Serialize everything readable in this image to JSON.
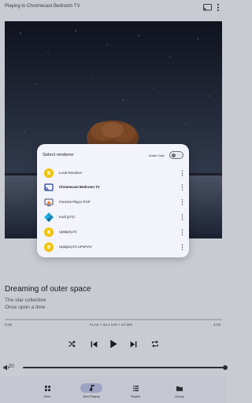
{
  "topbar": {
    "title": "Playing to Chromecast Bedroom TV"
  },
  "song": {
    "title": "Dreaming of outer space",
    "artist": "The star collective",
    "album": "Once upon a time"
  },
  "playback": {
    "elapsed": "0:00",
    "format": "FLAC • 44.1 kHz • 24 bits",
    "duration": "4:02",
    "progress": 0
  },
  "volume": {
    "value": "20",
    "level": 1.0
  },
  "nav": [
    {
      "label": "Store",
      "icon": "grid-icon"
    },
    {
      "label": "Now Playing",
      "icon": "music-note-icon"
    },
    {
      "label": "Playlist",
      "icon": "list-icon"
    },
    {
      "label": "Library",
      "icon": "folder-icon"
    }
  ],
  "dialog": {
    "title": "Select renderer",
    "audio_cast_label": "Audio Cast",
    "renderers": [
      {
        "label": "Local Renderer",
        "icon": "local-renderer-icon"
      },
      {
        "label": "Chromecast Bedroom TV",
        "icon": "cast-icon",
        "selected": true
      },
      {
        "label": "Firestick Player POP",
        "icon": "firestick-icon"
      },
      {
        "label": "Kodi (p72)",
        "icon": "kodi-icon"
      },
      {
        "label": "UpMpd-p72",
        "icon": "upnp-icon"
      },
      {
        "label": "UpMpd-p72-UPnP/AV",
        "icon": "upnp-icon"
      }
    ]
  },
  "colors": {
    "accent": "#9ea3c2",
    "scrim": "#c9cbd3",
    "dialog_bg": "#f3f3fb",
    "renderer_yellow": "#f2c20a"
  }
}
